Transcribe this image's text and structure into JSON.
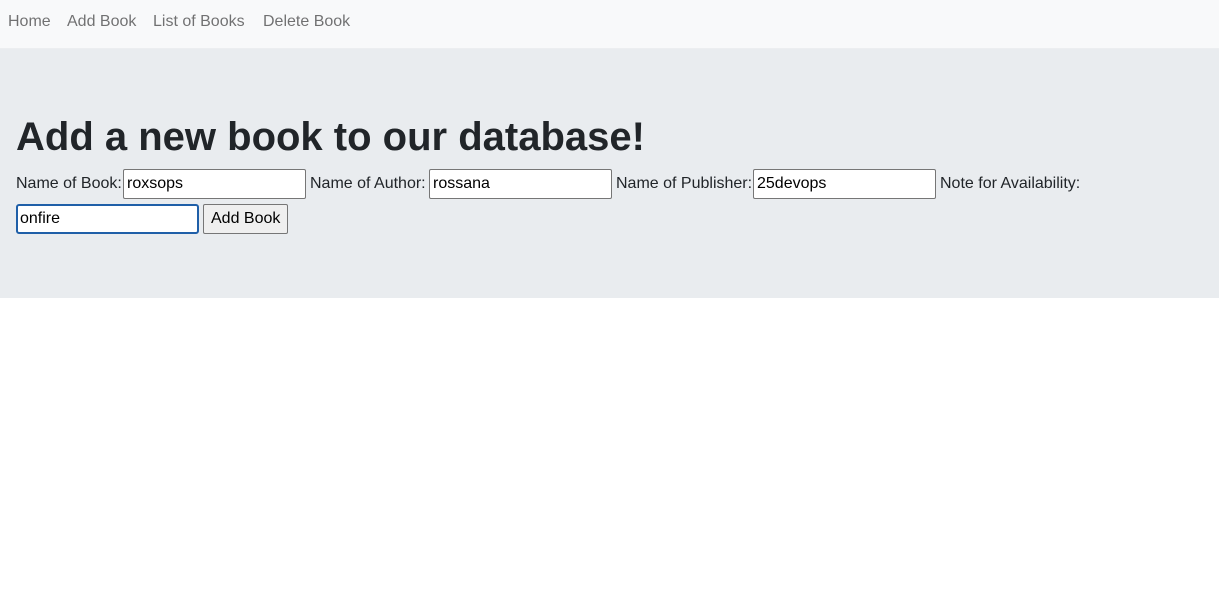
{
  "nav": {
    "items": [
      {
        "label": "Home"
      },
      {
        "label": "Add Book"
      },
      {
        "label": "List of Books"
      },
      {
        "label": "Delete Book"
      }
    ]
  },
  "main": {
    "title": "Add a new book to our database!",
    "form": {
      "book_name_label": "Name of Book:",
      "book_name_value": "roxsops",
      "author_label": "Name of Author:",
      "author_value": "rossana",
      "publisher_label": "Name of Publisher:",
      "publisher_value": "25devops",
      "availability_label": "Note for Availability:",
      "availability_value": "onfire",
      "submit_label": "Add Book"
    }
  }
}
